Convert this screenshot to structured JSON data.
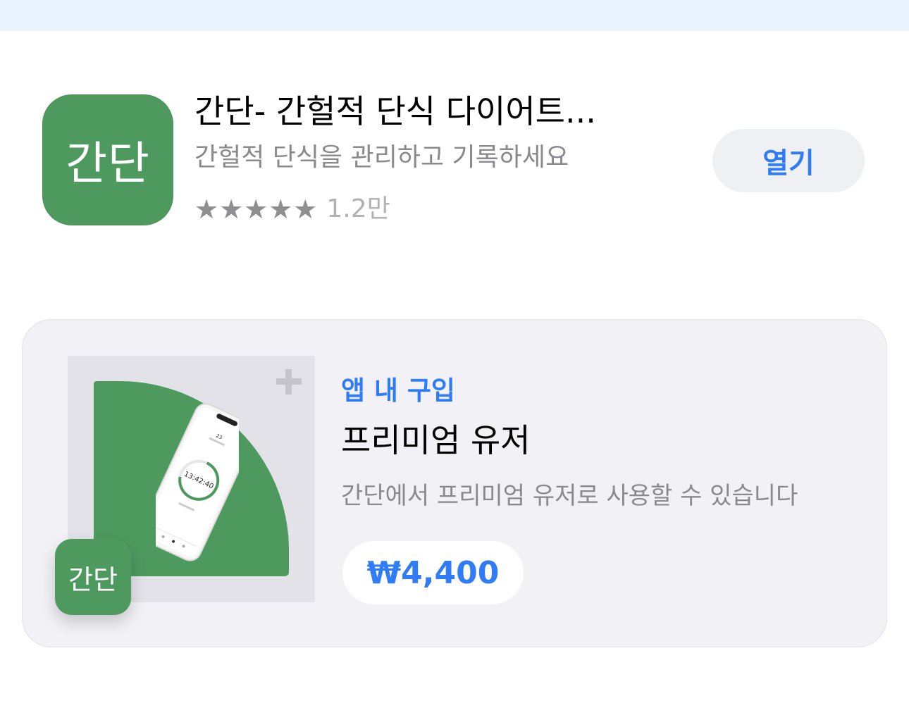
{
  "app": {
    "icon_text": "간단",
    "title": "간단- 간헐적 단식 다이어트...",
    "subtitle": "간헐적 단식을 관리하고 기록하세요",
    "rating_stars": 5,
    "rating_count": "1.2만",
    "open_label": "열기"
  },
  "iap": {
    "kicker": "앱 내 구입",
    "title": "프리미엄 유저",
    "description": "간단에서 프리미엄 유저로 사용할 수 있습니다",
    "price": "₩4,400",
    "image_app_icon_text": "간단",
    "phone_screen": {
      "date": "23",
      "timer": "13:42:40"
    }
  },
  "colors": {
    "brand_green": "#4e9a5e",
    "accent_blue": "#2f7cf6",
    "card_bg": "#f1f1f6",
    "top_strip": "#eaf2fd"
  },
  "icons": {
    "star": "star-icon",
    "plus": "plus-icon"
  }
}
